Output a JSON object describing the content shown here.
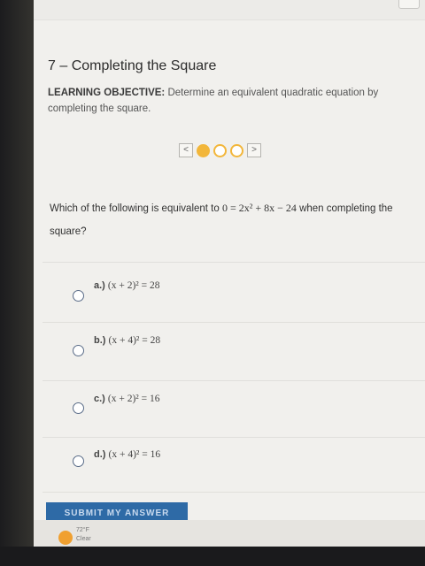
{
  "lesson": {
    "title": "7 – Completing the Square",
    "objective_label": "LEARNING OBJECTIVE:",
    "objective_text": "Determine an equivalent quadratic equation by completing the square."
  },
  "progress": {
    "prev_icon": "chevron-left-icon",
    "next_icon": "chevron-right-icon",
    "prev_glyph": "<",
    "next_glyph": ">",
    "total": 3,
    "current": 1,
    "accent": "#f2b63a"
  },
  "question": {
    "prefix": "Which of the following is equivalent to ",
    "equation": "0 = 2x² + 8x − 24",
    "suffix": " when completing the square?"
  },
  "options": [
    {
      "letter": "a.)",
      "expr": "(x + 2)² = 28"
    },
    {
      "letter": "b.)",
      "expr": "(x + 4)² = 28"
    },
    {
      "letter": "c.)",
      "expr": "(x + 2)² = 16"
    },
    {
      "letter": "d.)",
      "expr": "(x + 4)² = 16"
    }
  ],
  "submit_label": "SUBMIT MY ANSWER",
  "taskbar": {
    "weather_temp": "72°F",
    "weather_desc": "Clear"
  }
}
